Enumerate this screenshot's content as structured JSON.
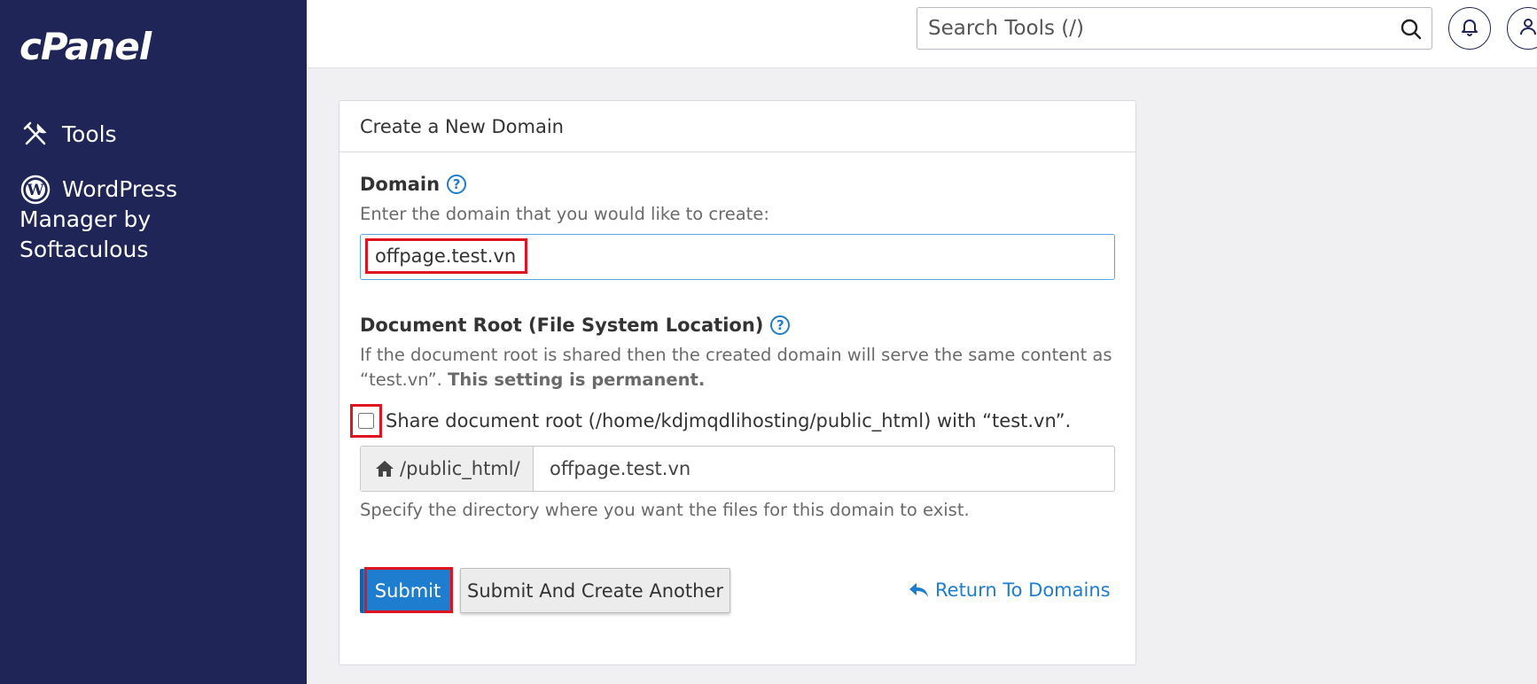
{
  "app": {
    "logo_text": "cPanel"
  },
  "sidebar": {
    "items": [
      {
        "label": "Tools",
        "icon": "tools-icon"
      },
      {
        "label_lines": [
          "WordPress",
          "Manager by",
          "Softaculous"
        ],
        "icon": "wordpress-icon"
      }
    ]
  },
  "topbar": {
    "search_placeholder": "Search Tools (/)"
  },
  "panel": {
    "title": "Create a New Domain",
    "domain": {
      "label": "Domain",
      "description": "Enter the domain that you would like to create:",
      "value": "offpage.test.vn"
    },
    "docroot": {
      "label": "Document Root (File System Location)",
      "description_line1": "If the document root is shared then the created domain will serve the same content as",
      "description_line2_prefix": "“test.vn”. ",
      "description_line2_bold": "This setting is permanent.",
      "share_label": "Share document root (/home/kdjmqdlihosting/public_html) with “test.vn”.",
      "share_checked": false,
      "prefix": "/public_html/",
      "value": "offpage.test.vn",
      "hint": "Specify the directory where you want the files for this domain to exist."
    },
    "buttons": {
      "submit": "Submit",
      "submit_another": "Submit And Create Another",
      "return": "Return To Domains"
    }
  },
  "colors": {
    "sidebar_bg": "#1f2556",
    "accent": "#1f7dd0",
    "highlight": "#e0141e"
  }
}
